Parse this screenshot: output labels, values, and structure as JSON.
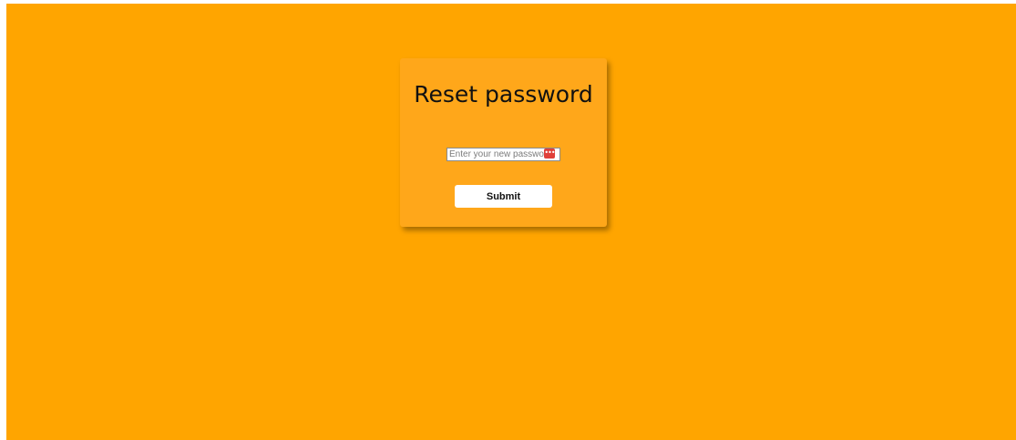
{
  "page": {
    "background_color": "#ffa500",
    "card_color": "#ffa71a"
  },
  "reset_form": {
    "title": "Reset password",
    "password_input": {
      "value": "",
      "placeholder": "Enter your new password"
    },
    "password_manager_icon": "password-manager-icon",
    "submit_label": "Submit"
  }
}
